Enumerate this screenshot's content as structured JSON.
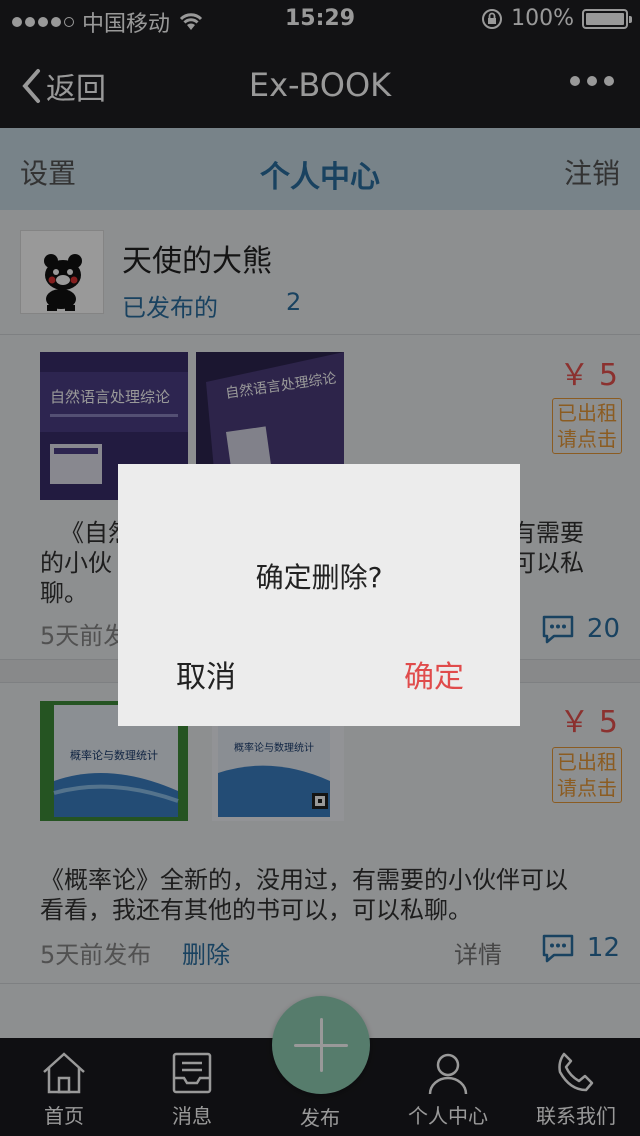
{
  "status": {
    "carrier": "中国移动",
    "time": "15:29",
    "battery": "100%"
  },
  "nav": {
    "back_label": "返回",
    "title": "Ex-BOOK"
  },
  "tabs": {
    "left": "设置",
    "center": "个人中心",
    "right": "注销"
  },
  "profile": {
    "username": "天使的大熊",
    "published_label": "已发布的",
    "published_count": "2"
  },
  "posts": [
    {
      "price": "￥ 5",
      "stamp_line1": "已出租",
      "stamp_line2": "请点击",
      "desc_line1": "《自然",
      "desc_line1_right": "有需要",
      "desc_line2": "的小伙",
      "desc_line2_right": "可以私",
      "desc_line3": "聊。",
      "time": "5天前发",
      "comments": "20",
      "book_title_1": "自然语言处理综论",
      "book_title_2": "自然语言处理综论"
    },
    {
      "price": "￥ 5",
      "stamp_line1": "已出租",
      "stamp_line2": "请点击",
      "desc_line1": "《概率论》全新的，没用过，有需要的小伙伴可以",
      "desc_line2": "看看，我还有其他的书可以，可以私聊。",
      "time": "5天前发布",
      "delete_label": "删除",
      "detail_label": "详情",
      "comments": "12",
      "book_title_1": "概率论与数理统计",
      "book_title_2": "概率论与数理统计"
    }
  ],
  "tabbar": {
    "home": "首页",
    "messages": "消息",
    "publish": "发布",
    "profile": "个人中心",
    "contact": "联系我们"
  },
  "dialog": {
    "message": "确定删除?",
    "cancel": "取消",
    "confirm": "确定"
  },
  "colors": {
    "accent_blue": "#2a6fa1",
    "price_red": "#e8534f",
    "stamp_orange": "#e89a3a",
    "fab_green": "#8fcfb4"
  }
}
